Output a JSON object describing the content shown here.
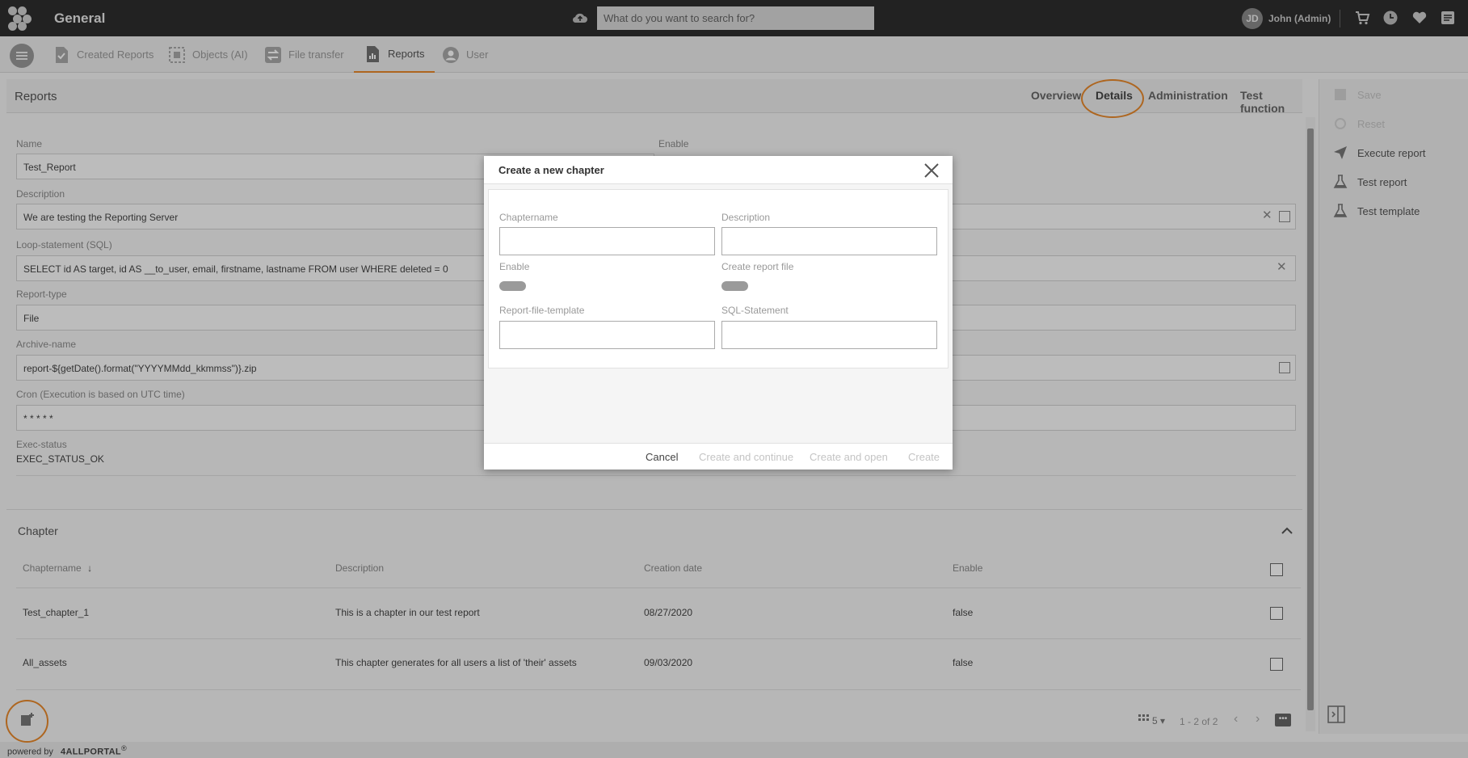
{
  "app": {
    "title": "General"
  },
  "search": {
    "placeholder": "What do you want to search for?"
  },
  "user": {
    "initials": "JD",
    "name": "John (Admin)"
  },
  "nav": {
    "tabs": [
      {
        "label": "Created Reports"
      },
      {
        "label": "Objects (AI)"
      },
      {
        "label": "File transfer"
      },
      {
        "label": "Reports"
      },
      {
        "label": "User"
      }
    ]
  },
  "panel": {
    "title": "Reports",
    "tabs": [
      {
        "label": "Overview"
      },
      {
        "label": "Details"
      },
      {
        "label": "Administration"
      },
      {
        "label": "Test function"
      }
    ]
  },
  "form": {
    "name_label": "Name",
    "name_value": "Test_Report",
    "enable_label": "Enable",
    "description_label": "Description",
    "description_value": "We are testing the Reporting Server",
    "loop_label": "Loop-statement (SQL)",
    "loop_value": "SELECT id AS target, id AS __to_user, email, firstname, lastname FROM user WHERE deleted = 0",
    "reporttype_label": "Report-type",
    "reporttype_value": "File",
    "archive_label": "Archive-name",
    "archive_value": "report-${getDate().format(\"YYYYMMdd_kkmmss\")}.zip",
    "cron_label": "Cron (Execution is based on UTC time)",
    "cron_value": "* * * * *",
    "exec_label": "Exec-status",
    "exec_value": "EXEC_STATUS_OK"
  },
  "sidebar": {
    "actions": [
      {
        "label": "Save",
        "icon": "save-icon",
        "enabled": false
      },
      {
        "label": "Reset",
        "icon": "reset-icon",
        "enabled": false
      },
      {
        "label": "Execute report",
        "icon": "send-icon",
        "enabled": true
      },
      {
        "label": "Test report",
        "icon": "flask-icon",
        "enabled": true
      },
      {
        "label": "Test template",
        "icon": "flask-icon",
        "enabled": true
      }
    ]
  },
  "chapter": {
    "title": "Chapter",
    "columns": [
      "Chaptername",
      "Description",
      "Creation date",
      "Enable"
    ],
    "rows": [
      {
        "name": "Test_chapter_1",
        "description": "This is a chapter in our test report",
        "date": "08/27/2020",
        "enable": "false"
      },
      {
        "name": "All_assets",
        "description": "This chapter generates for all users a list of 'their' assets",
        "date": "09/03/2020",
        "enable": "false"
      }
    ],
    "page_size": "5",
    "range": "1 - 2 of 2"
  },
  "footer": {
    "prefix": "powered by",
    "brand": "4ALLPORTAL",
    "mark": "®"
  },
  "dialog": {
    "title": "Create a new chapter",
    "fields": {
      "chaptername_label": "Chaptername",
      "description_label": "Description",
      "enable_label": "Enable",
      "create_file_label": "Create report file",
      "template_label": "Report-file-template",
      "sql_label": "SQL-Statement"
    },
    "buttons": {
      "cancel": "Cancel",
      "create_continue": "Create and continue",
      "create_open": "Create and open",
      "create": "Create"
    }
  },
  "colors": {
    "accent": "#e8892b",
    "topbar": "#2e2e2e"
  }
}
